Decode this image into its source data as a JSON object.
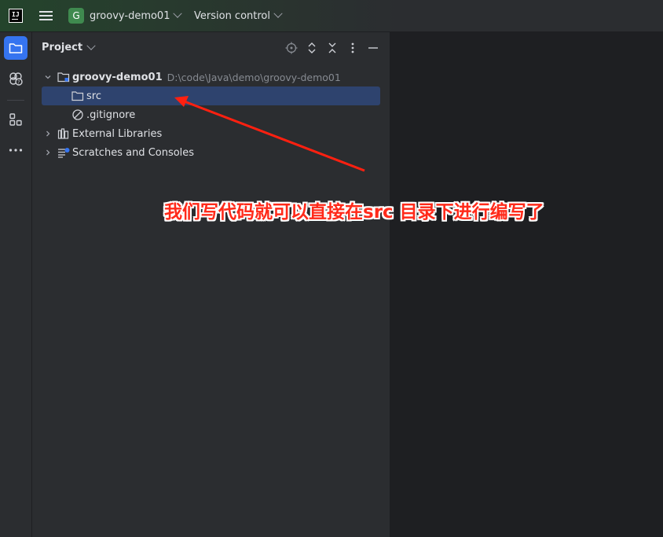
{
  "titlebar": {
    "logo_text": "IJ",
    "project_badge": "G",
    "project_name": "groovy-demo01",
    "vcs_label": "Version control"
  },
  "left_toolbar": {
    "items": [
      {
        "icon": "folder-icon",
        "active": true
      },
      {
        "icon": "plugins-icon",
        "active": false
      },
      {
        "icon": "structure-icon",
        "active": false
      },
      {
        "icon": "more-icon",
        "active": false
      }
    ]
  },
  "project_panel": {
    "title": "Project",
    "tools": [
      "locate-icon",
      "expand-all-icon",
      "collapse-all-icon",
      "options-icon",
      "hide-icon"
    ],
    "tree": [
      {
        "label": "groovy-demo01",
        "path": "D:\\code\\Java\\demo\\groovy-demo01",
        "icon": "module-folder-icon",
        "expanded": true
      },
      {
        "label": "src",
        "icon": "folder-icon",
        "selected": true
      },
      {
        "label": ".gitignore",
        "icon": "ignore-file-icon"
      },
      {
        "label": "External Libraries",
        "icon": "library-icon",
        "expanded": false
      },
      {
        "label": "Scratches and Consoles",
        "icon": "scratches-icon",
        "expanded": false
      }
    ]
  },
  "annotation": {
    "text": "我们写代码就可以直接在src 目录下进行编写了",
    "color": "#ff2a1a"
  },
  "colors": {
    "accent": "#3574f0",
    "selection": "#2e436e",
    "panel_bg": "#2b2d30",
    "editor_bg": "#1e1f22"
  }
}
